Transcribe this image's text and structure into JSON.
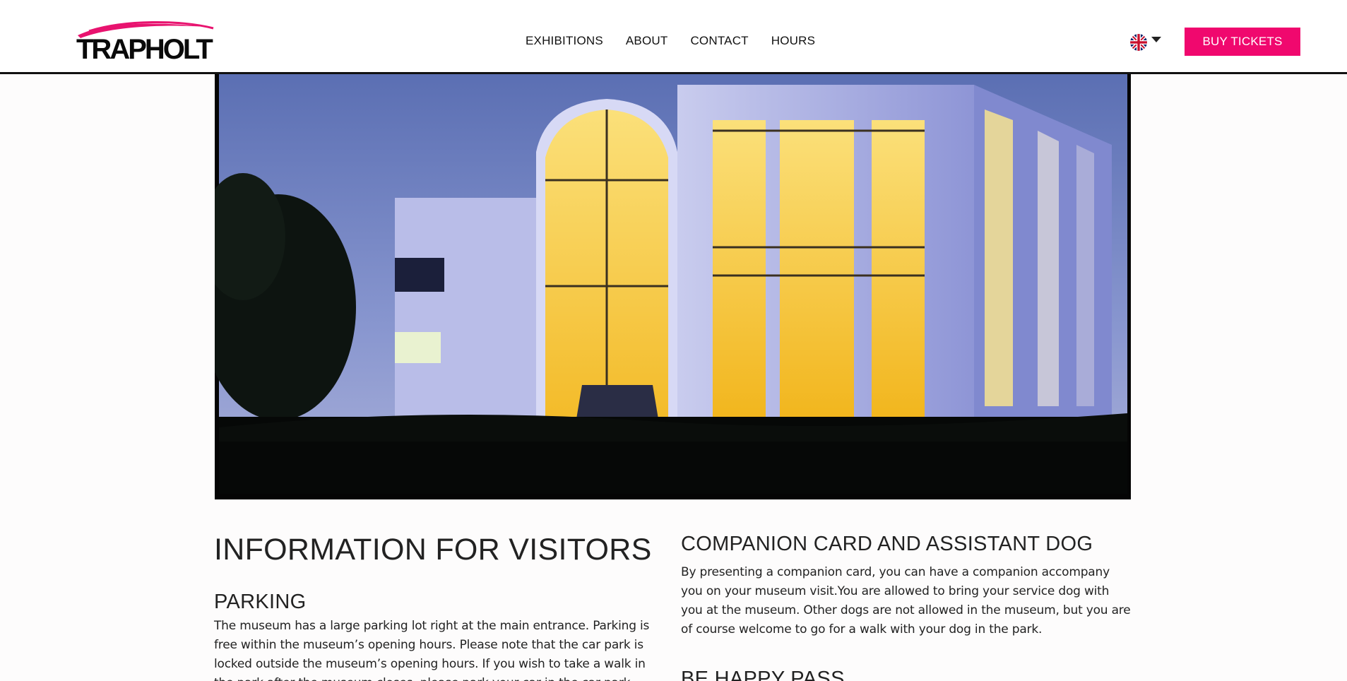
{
  "header": {
    "logo_text": "TRAPHOLT",
    "nav": [
      {
        "label": "EXHIBITIONS"
      },
      {
        "label": "ABOUT"
      },
      {
        "label": "CONTACT"
      },
      {
        "label": "HOURS"
      }
    ],
    "language": {
      "icon": "uk-flag-icon",
      "dropdown_icon": "caret-down-icon"
    },
    "buy_tickets_label": "BUY TICKETS",
    "accent_color": "#f0086e"
  },
  "hero": {
    "image": "museum-building-at-dusk"
  },
  "content": {
    "left": {
      "title": "INFORMATION FOR VISITORS",
      "parking_heading": "PARKING",
      "parking_text": "The museum has a large parking lot right at the main entrance. Parking is free within the museum’s opening hours. Please note that the car park is locked outside the museum’s opening hours. If you wish to take a walk in the park after the museum closes, please park your car in the car park placed by the entrance outside the"
    },
    "right": {
      "companion_heading": "COMPANION CARD AND ASSISTANT DOG",
      "companion_text": "By presenting a companion card, you can have a companion accompany you on your museum visit.You are allowed to bring your service dog with you at the museum. Other dogs are not allowed in the museum, but you are of course welcome to go for a walk with your dog in the park.",
      "be_happy_heading": "BE HAPPY PASS"
    }
  }
}
